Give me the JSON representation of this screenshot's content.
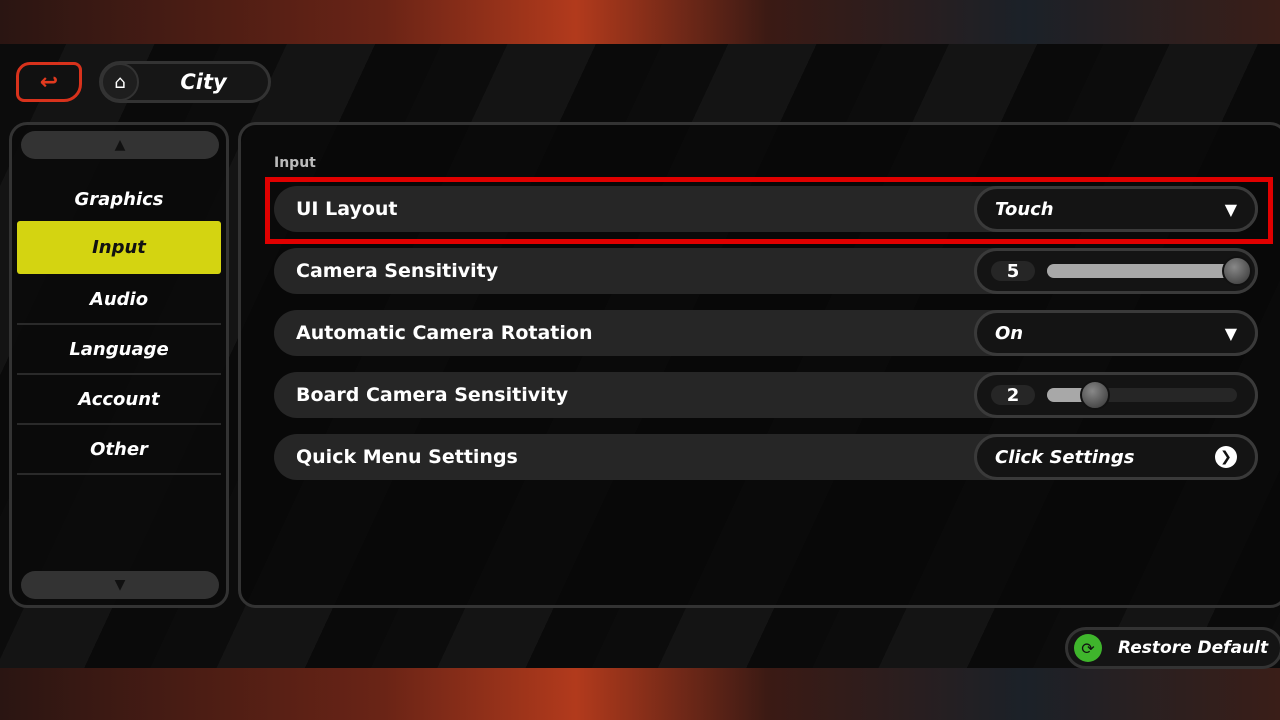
{
  "header": {
    "back_icon": "back-arrow-icon",
    "home_icon": "home-icon",
    "breadcrumb": "City"
  },
  "sidebar": {
    "items": [
      {
        "label": "Graphics"
      },
      {
        "label": "Input",
        "active": true
      },
      {
        "label": "Audio"
      },
      {
        "label": "Language"
      },
      {
        "label": "Account"
      },
      {
        "label": "Other"
      }
    ],
    "active_color": "#d4d411"
  },
  "main": {
    "section": "Input",
    "settings": [
      {
        "label": "UI Layout",
        "type": "dropdown",
        "value": "Touch",
        "highlighted": true
      },
      {
        "label": "Camera Sensitivity",
        "type": "slider",
        "value": "5",
        "fraction": 1.0
      },
      {
        "label": "Automatic Camera Rotation",
        "type": "dropdown",
        "value": "On"
      },
      {
        "label": "Board Camera Sensitivity",
        "type": "slider",
        "value": "2",
        "fraction": 0.25
      },
      {
        "label": "Quick Menu Settings",
        "type": "link",
        "value": "Click Settings"
      }
    ]
  },
  "footer": {
    "restore": "Restore Default",
    "restore_icon_color": "#3fb52c"
  },
  "highlight_color": "#e00000"
}
